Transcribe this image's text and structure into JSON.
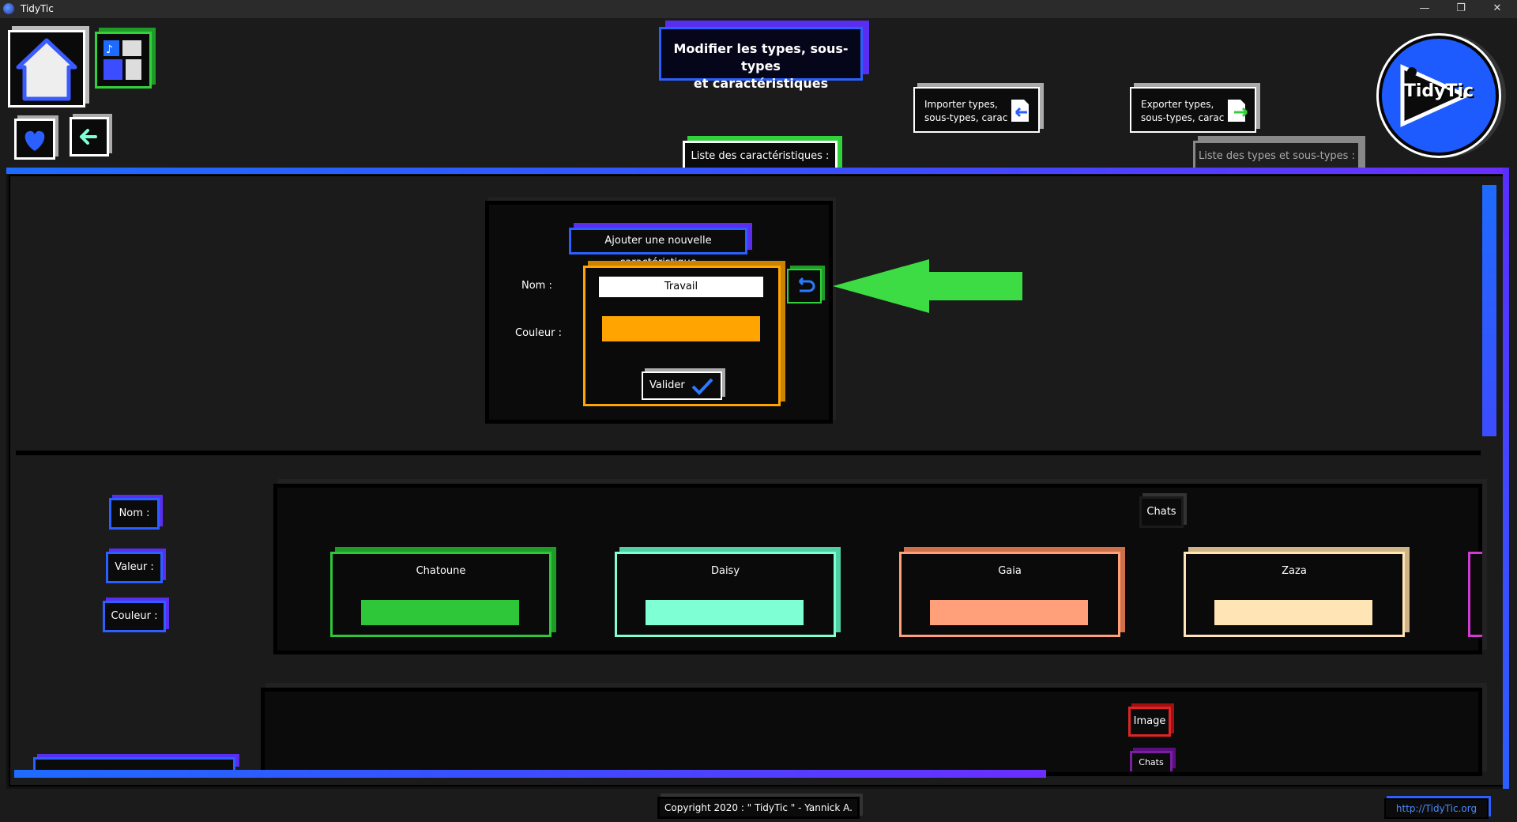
{
  "window": {
    "title": "TidyTic",
    "minimize": "—",
    "restore": "❐",
    "close": "✕"
  },
  "header": {
    "title_line1": "Modifier les types, sous-types",
    "title_line2": "et caractéristiques"
  },
  "import_btn": {
    "line1": "Importer types,",
    "line2": "sous-types, carac"
  },
  "export_btn": {
    "line1": "Exporter types,",
    "line2": "sous-types, carac"
  },
  "tabs": {
    "carac": "Liste des caractéristiques :",
    "types": "Liste des types et sous-types :"
  },
  "logo": {
    "text": "TidyTic"
  },
  "form": {
    "title": "Ajouter une nouvelle caractéristique",
    "nom_label": "Nom :",
    "couleur_label": "Couleur :",
    "nom_value": "Travail",
    "couleur_value": "#ffa400",
    "submit": "Valider"
  },
  "filters": {
    "nom": "Nom :",
    "valeur": "Valeur :",
    "couleur": "Couleur :"
  },
  "group": {
    "title": "Chats",
    "items": [
      {
        "name": "Chatoune",
        "color": "#2ec73a"
      },
      {
        "name": "Daisy",
        "color": "#7fffd4"
      },
      {
        "name": "Gaia",
        "color": "#ffa07a"
      },
      {
        "name": "Zaza",
        "color": "#ffe4b5"
      }
    ]
  },
  "group2": {
    "tag1": "Image",
    "tag2": "Chats"
  },
  "footer": {
    "copyright": "Copyright 2020 : \" TidyTic \" - Yannick A.",
    "website": "http://TidyTic.org"
  }
}
